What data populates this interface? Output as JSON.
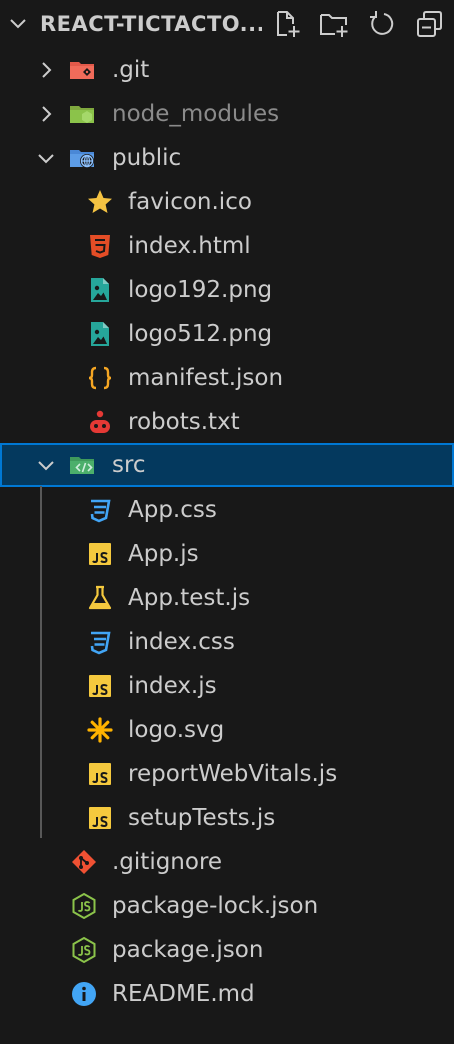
{
  "explorer": {
    "title": "REACT-TICTACTO...",
    "actions": [
      {
        "name": "new-file-icon"
      },
      {
        "name": "new-folder-icon"
      },
      {
        "name": "refresh-icon"
      },
      {
        "name": "collapse-all-icon"
      }
    ]
  },
  "tree": [
    {
      "label": ".git",
      "type": "folder",
      "expanded": false,
      "icon": "git-folder-icon"
    },
    {
      "label": "node_modules",
      "type": "folder",
      "expanded": false,
      "icon": "node-folder-icon",
      "dimmed": true
    },
    {
      "label": "public",
      "type": "folder",
      "expanded": true,
      "icon": "public-folder-icon"
    },
    {
      "label": "favicon.ico",
      "type": "file",
      "icon": "star-icon"
    },
    {
      "label": "index.html",
      "type": "file",
      "icon": "html5-icon"
    },
    {
      "label": "logo192.png",
      "type": "file",
      "icon": "image-icon"
    },
    {
      "label": "logo512.png",
      "type": "file",
      "icon": "image-icon"
    },
    {
      "label": "manifest.json",
      "type": "file",
      "icon": "json-braces-icon"
    },
    {
      "label": "robots.txt",
      "type": "file",
      "icon": "robot-icon"
    },
    {
      "label": "src",
      "type": "folder",
      "expanded": true,
      "icon": "src-folder-icon",
      "selected": true
    },
    {
      "label": "App.css",
      "type": "file",
      "icon": "css3-icon"
    },
    {
      "label": "App.js",
      "type": "file",
      "icon": "js-icon"
    },
    {
      "label": "App.test.js",
      "type": "file",
      "icon": "flask-icon"
    },
    {
      "label": "index.css",
      "type": "file",
      "icon": "css3-icon"
    },
    {
      "label": "index.js",
      "type": "file",
      "icon": "js-icon"
    },
    {
      "label": "logo.svg",
      "type": "file",
      "icon": "asterisk-icon"
    },
    {
      "label": "reportWebVitals.js",
      "type": "file",
      "icon": "js-icon"
    },
    {
      "label": "setupTests.js",
      "type": "file",
      "icon": "js-icon"
    },
    {
      "label": ".gitignore",
      "type": "file",
      "icon": "git-icon"
    },
    {
      "label": "package-lock.json",
      "type": "file",
      "icon": "nodejs-icon"
    },
    {
      "label": "package.json",
      "type": "file",
      "icon": "nodejs-icon"
    },
    {
      "label": "README.md",
      "type": "file",
      "icon": "info-icon"
    }
  ],
  "colors": {
    "background": "#181818",
    "selection": "#04395e",
    "focus_border": "#0078d4",
    "text": "#cccccc"
  }
}
